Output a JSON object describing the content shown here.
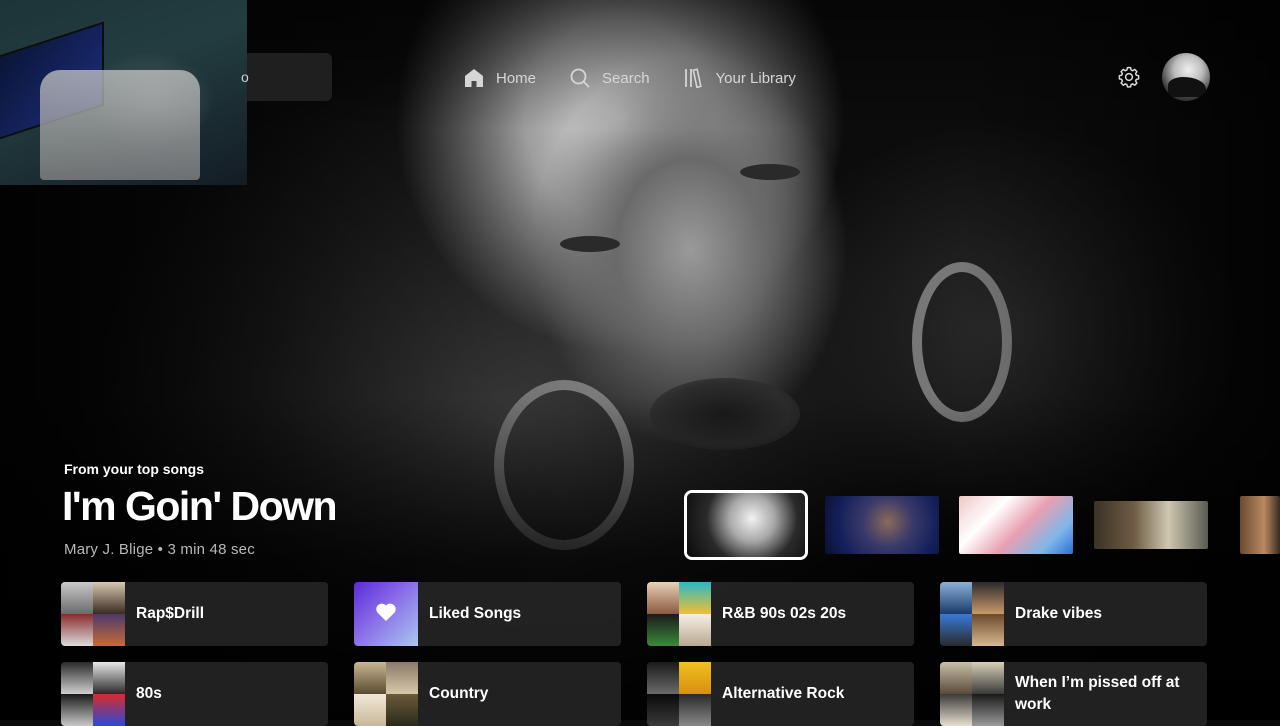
{
  "nav": {
    "home_label": "Home",
    "search_label": "Search",
    "library_label": "Your Library"
  },
  "search_stub": {
    "text": "o"
  },
  "hero": {
    "eyebrow": "From your top songs",
    "title": "I'm Goin' Down",
    "meta": "Mary J. Blige • 3 min 48 sec"
  },
  "carousel": {
    "selected_index": 0,
    "count": 5
  },
  "shortcuts": [
    {
      "label": "Rap$Drill"
    },
    {
      "label": "Liked Songs"
    },
    {
      "label": "R&B 90s 02s 20s"
    },
    {
      "label": "Drake vibes"
    },
    {
      "label": "80s"
    },
    {
      "label": "Country"
    },
    {
      "label": "Alternative Rock"
    },
    {
      "label": "When I’m pissed off at work"
    }
  ],
  "icons": {
    "home": "home-icon",
    "search": "search-icon",
    "library": "library-icon",
    "settings": "gear-icon",
    "liked": "heart-icon"
  },
  "colors": {
    "liked_gradient_start": "#5b2bd8",
    "liked_gradient_end": "#a9c8f0",
    "tile_bg": "#282828"
  }
}
